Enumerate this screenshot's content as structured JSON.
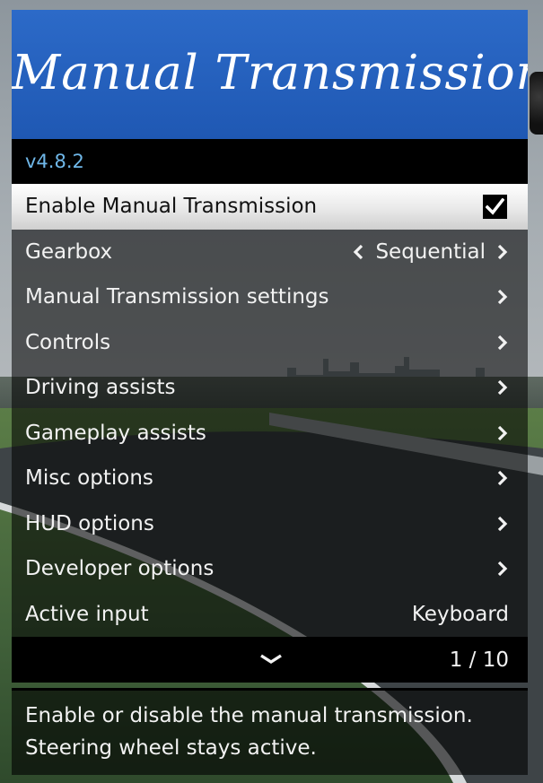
{
  "header": {
    "title": "Manual Transmission"
  },
  "subtitle": {
    "version": "v4.8.2"
  },
  "items": [
    {
      "label": "Enable Manual Transmission",
      "checked": true
    },
    {
      "label": "Gearbox",
      "value": "Sequential"
    },
    {
      "label": "Manual Transmission settings"
    },
    {
      "label": "Controls"
    },
    {
      "label": "Driving assists"
    },
    {
      "label": "Gameplay assists"
    },
    {
      "label": "Misc options"
    },
    {
      "label": "HUD options"
    },
    {
      "label": "Developer options"
    },
    {
      "label": "Active input",
      "value": "Keyboard"
    }
  ],
  "footer": {
    "page": "1 / 10"
  },
  "description": {
    "line1": "Enable or disable the manual transmission.",
    "line2": "Steering wheel stays active."
  },
  "colors": {
    "header_blue": "#2563c0",
    "version_text": "#6fb7e8",
    "selected_row": "#ffffff"
  },
  "icons": {
    "checkbox": "check-icon",
    "submenu": "chevron-right-icon",
    "selector_left": "chevron-left-icon",
    "scroll": "chevron-down-icon"
  }
}
